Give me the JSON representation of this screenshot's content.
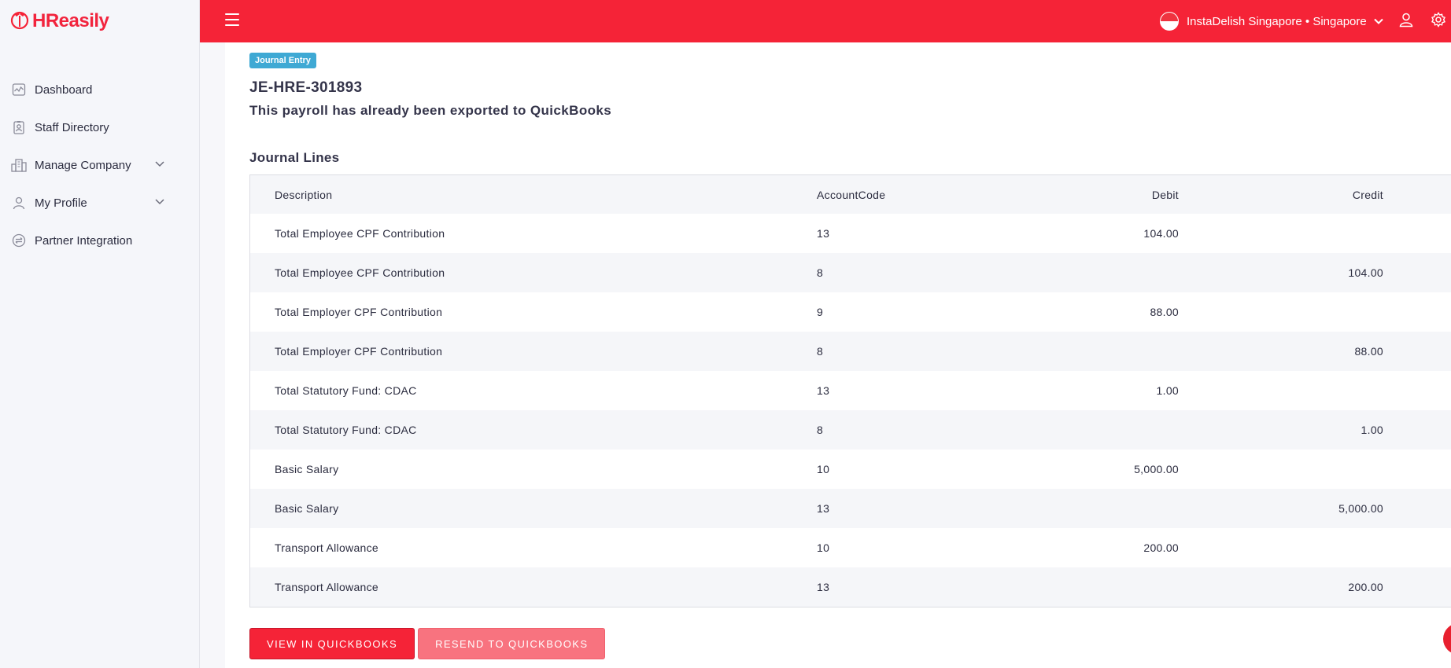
{
  "app": {
    "logo_text": "HReasily",
    "brand_color": "#f52337"
  },
  "sidebar": {
    "items": [
      {
        "label": "Dashboard",
        "icon": "activity-chart-icon"
      },
      {
        "label": "Staff Directory",
        "icon": "id-badge-icon"
      },
      {
        "label": "Manage Company",
        "icon": "building-icon",
        "expandable": true
      },
      {
        "label": "My Profile",
        "icon": "user-icon",
        "expandable": true
      },
      {
        "label": "Partner Integration",
        "icon": "integration-icon"
      }
    ]
  },
  "header": {
    "company": "InstaDelish Singapore • Singapore",
    "icons": [
      "menu-icon",
      "singapore-flag-icon",
      "chevron-down-icon",
      "user-icon",
      "settings-icon"
    ]
  },
  "journal": {
    "badge": "Journal Entry",
    "id": "JE-HRE-301893",
    "message": "This payroll has already been exported to QuickBooks",
    "lines_title": "Journal Lines",
    "columns": {
      "description": "Description",
      "account_code": "AccountCode",
      "debit": "Debit",
      "credit": "Credit"
    },
    "rows": [
      {
        "description": "Total Employee CPF Contribution",
        "account_code": "13",
        "debit": "104.00",
        "credit": ""
      },
      {
        "description": "Total Employee CPF Contribution",
        "account_code": "8",
        "debit": "",
        "credit": "104.00"
      },
      {
        "description": "Total Employer CPF Contribution",
        "account_code": "9",
        "debit": "88.00",
        "credit": ""
      },
      {
        "description": "Total Employer CPF Contribution",
        "account_code": "8",
        "debit": "",
        "credit": "88.00"
      },
      {
        "description": "Total Statutory Fund: CDAC",
        "account_code": "13",
        "debit": "1.00",
        "credit": ""
      },
      {
        "description": "Total Statutory Fund: CDAC",
        "account_code": "8",
        "debit": "",
        "credit": "1.00"
      },
      {
        "description": "Basic Salary",
        "account_code": "10",
        "debit": "5,000.00",
        "credit": ""
      },
      {
        "description": "Basic Salary",
        "account_code": "13",
        "debit": "",
        "credit": "5,000.00"
      },
      {
        "description": "Transport Allowance",
        "account_code": "10",
        "debit": "200.00",
        "credit": ""
      },
      {
        "description": "Transport Allowance",
        "account_code": "13",
        "debit": "",
        "credit": "200.00"
      }
    ]
  },
  "actions": {
    "view": "VIEW IN QUICKBOOKS",
    "resend": "RESEND TO QUICKBOOKS"
  }
}
